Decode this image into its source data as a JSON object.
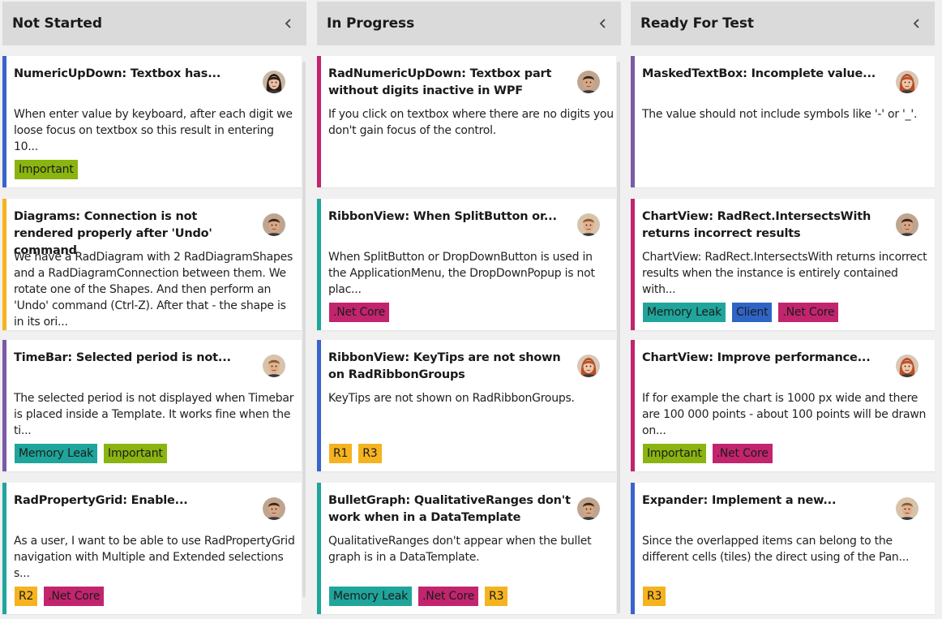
{
  "colors": {
    "blue": "#3a63cc",
    "yellow": "#f5b320",
    "purple": "#7b5aa6",
    "magenta": "#c2246e",
    "teal": "#1fa59b",
    "green": "#8ab40f",
    "tag_blue": "#2f64c6"
  },
  "columns": [
    {
      "title": "Not Started",
      "cards": [
        {
          "title": "NumericUpDown: Textbox has...",
          "description": "When enter value by keyboard, after each digit we loose focus on textbox so this result in entering 10...",
          "accent": "blue",
          "avatar": "woman-dark-hair",
          "tags": [
            {
              "label": "Important",
              "color": "green"
            }
          ]
        },
        {
          "title": "Diagrams: Connection is not rendered properly after 'Undo' command",
          "description": "We have a RadDiagram with 2 RadDiagramShapes and a RadDiagramConnection between them. We rotate one of the Shapes. And then perform an 'Undo' command (Ctrl-Z). After that - the shape is in its ori...",
          "accent": "yellow",
          "avatar": "man-dark-hair",
          "tags": []
        },
        {
          "title": "TimeBar: Selected period is not...",
          "description": "The selected period is not displayed when Timebar is placed inside a Template. It works fine when the ti...",
          "accent": "purple",
          "avatar": "man-light-hair",
          "tags": [
            {
              "label": "Memory Leak",
              "color": "teal"
            },
            {
              "label": "Important",
              "color": "green"
            }
          ]
        },
        {
          "title": "RadPropertyGrid: Enable...",
          "description": "As a user, I want to be able to use RadPropertyGrid navigation with Multiple and Extended selections s...",
          "accent": "teal",
          "avatar": "man-dark-hair",
          "tags": [
            {
              "label": "R2",
              "color": "yellow"
            },
            {
              "label": ".Net Core",
              "color": "magenta"
            }
          ]
        }
      ]
    },
    {
      "title": "In Progress",
      "cards": [
        {
          "title": "RadNumericUpDown: Textbox part without digits inactive in WPF",
          "description": "If you click on textbox where there are no digits you don't gain focus of the control.",
          "accent": "magenta",
          "avatar": "man-dark-hair",
          "tags": []
        },
        {
          "title": "RibbonView: When SplitButton or...",
          "description": "When SplitButton or DropDownButton is used in the ApplicationMenu, the DropDownPopup is not plac...",
          "accent": "teal",
          "avatar": "man-light-hair",
          "tags": [
            {
              "label": ".Net Core",
              "color": "magenta"
            }
          ]
        },
        {
          "title": "RibbonView: KeyTips are not shown on RadRibbonGroups",
          "description": "KeyTips are not shown on RadRibbonGroups.",
          "accent": "blue",
          "avatar": "woman-red-hair",
          "tags": [
            {
              "label": "R1",
              "color": "yellow"
            },
            {
              "label": "R3",
              "color": "yellow"
            }
          ]
        },
        {
          "title": "BulletGraph: QualitativeRanges don't work when in a DataTemplate",
          "description": "QualitativeRanges don't appear when the bullet graph is in a DataTemplate.",
          "accent": "teal",
          "avatar": "man-dark-hair",
          "tags": [
            {
              "label": "Memory Leak",
              "color": "teal"
            },
            {
              "label": ".Net Core",
              "color": "magenta"
            },
            {
              "label": "R3",
              "color": "yellow"
            }
          ]
        }
      ]
    },
    {
      "title": "Ready For Test",
      "cards": [
        {
          "title": "MaskedTextBox: Incomplete value...",
          "description": "The value should not include symbols like '-' or '_'.",
          "accent": "purple",
          "avatar": "woman-red-hair",
          "tags": []
        },
        {
          "title": "ChartView: RadRect.IntersectsWith returns incorrect results",
          "description": "ChartView: RadRect.IntersectsWith returns incorrect results when the instance is entirely contained with...",
          "accent": "magenta",
          "avatar": "man-dark-hair",
          "tags": [
            {
              "label": "Memory Leak",
              "color": "teal"
            },
            {
              "label": "Client",
              "color": "tag_blue"
            },
            {
              "label": ".Net Core",
              "color": "magenta"
            }
          ]
        },
        {
          "title": "ChartView: Improve performance...",
          "description": "If for example the chart is 1000 px wide and there are 100 000 points - about 100 points will be drawn on...",
          "accent": "magenta",
          "avatar": "woman-red-hair",
          "tags": [
            {
              "label": "Important",
              "color": "green"
            },
            {
              "label": ".Net Core",
              "color": "magenta"
            }
          ]
        },
        {
          "title": "Expander: Implement a new...",
          "description": "Since the overlapped items can belong to the different cells (tiles) the direct using of the Pan...",
          "accent": "blue",
          "avatar": "man-light-hair",
          "tags": [
            {
              "label": "R3",
              "color": "yellow"
            }
          ]
        }
      ]
    }
  ]
}
